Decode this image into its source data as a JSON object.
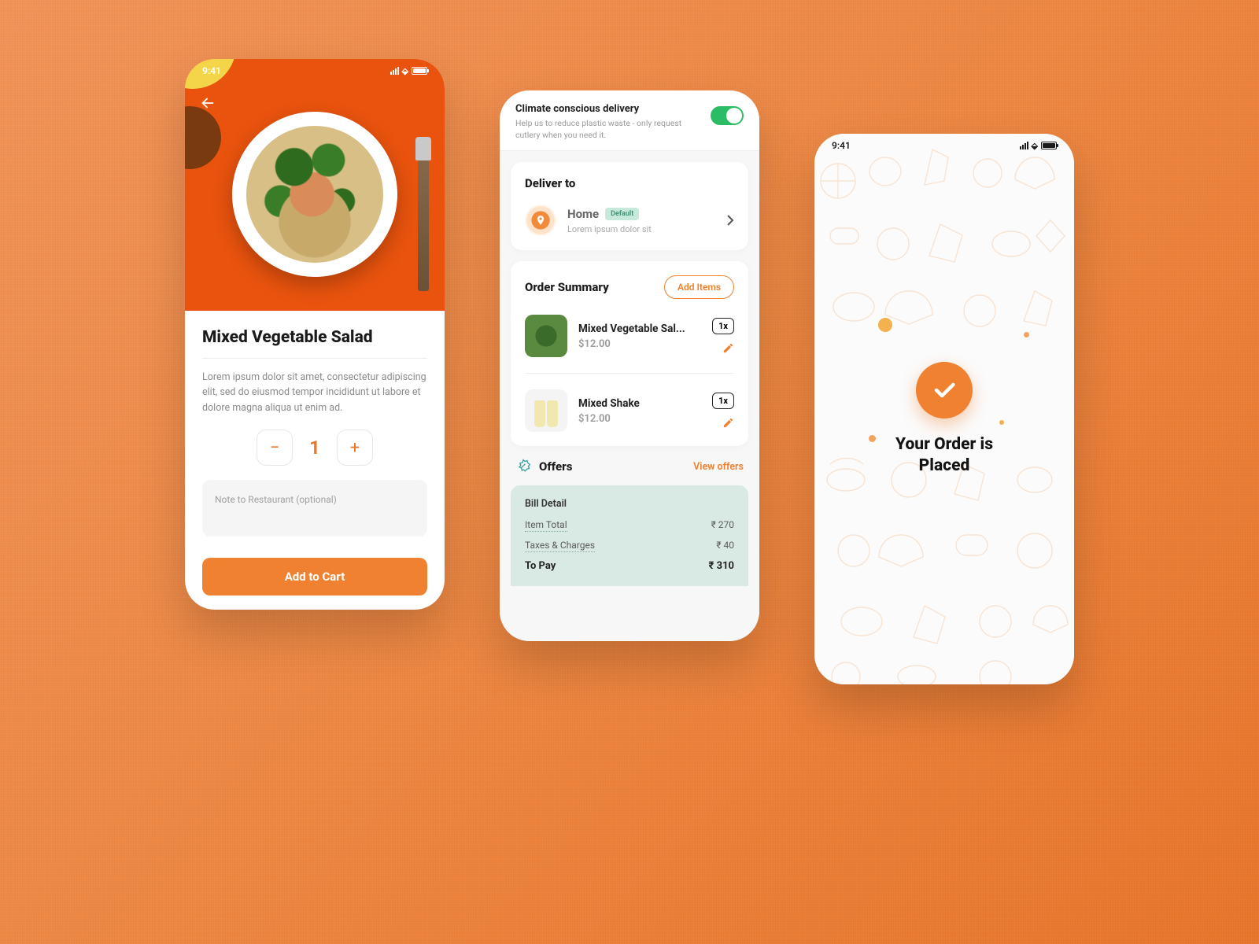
{
  "status_time": "9:41",
  "phone1": {
    "title": "Mixed Vegetable Salad",
    "description": "Lorem ipsum dolor sit amet, consectetur adipiscing elit, sed do eiusmod tempor incididunt ut labore et dolore magna aliqua ut enim ad.",
    "quantity": "1",
    "note_placeholder": "Note to Restaurant (optional)",
    "cta": "Add to Cart"
  },
  "phone2": {
    "climate": {
      "title": "Climate conscious delivery",
      "subtitle": "Help us to reduce plastic waste - only request cutlery when you need it."
    },
    "deliver_to_label": "Deliver to",
    "address": {
      "name": "Home",
      "badge": "Default",
      "line": "Lorem ipsum dolor sit"
    },
    "summary_label": "Order Summary",
    "add_items_label": "Add Items",
    "items": [
      {
        "name": "Mixed Vegetable Sal...",
        "price": "$12.00",
        "qty": "1x"
      },
      {
        "name": "Mixed Shake",
        "price": "$12.00",
        "qty": "1x"
      }
    ],
    "offers_label": "Offers",
    "view_offers_label": "View offers",
    "bill": {
      "title": "Bill Detail",
      "item_total_label": "Item Total",
      "item_total": "₹ 270",
      "taxes_label": "Taxes & Charges",
      "taxes": "₹ 40",
      "to_pay_label": "To Pay",
      "to_pay": "₹ 310"
    }
  },
  "phone3": {
    "title_line1": "Your Order is",
    "title_line2": "Placed"
  }
}
